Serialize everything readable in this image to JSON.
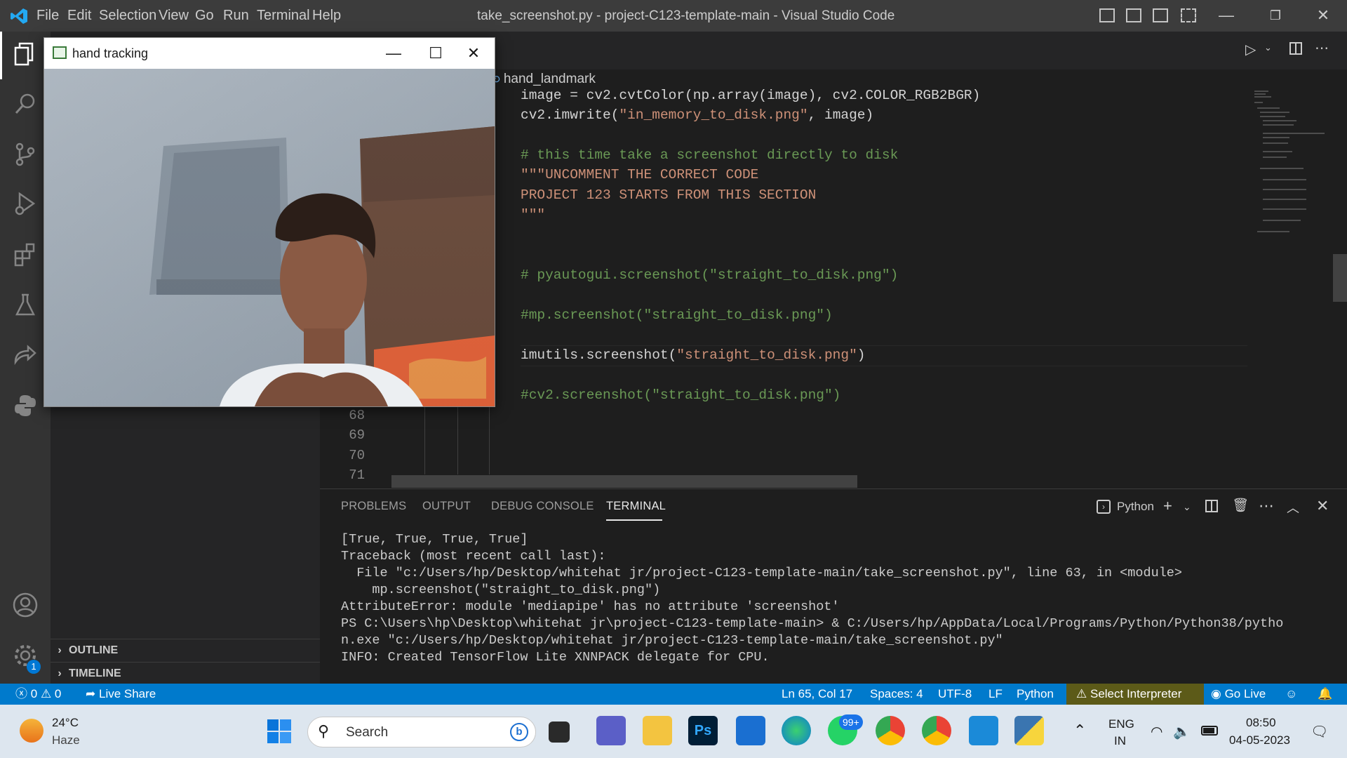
{
  "titlebar": {
    "menu": [
      "File",
      "Edit",
      "Selection",
      "View",
      "Go",
      "Run",
      "Terminal",
      "Help"
    ],
    "window_title": "take_screenshot.py - project-C123-template-main - Visual Studio Code"
  },
  "camera_window": {
    "title": "hand tracking",
    "minimize": "—",
    "maximize": "☐",
    "close": "✕"
  },
  "breadcrumb": {
    "symbol": "hand_landmark"
  },
  "code": {
    "line1_prefix": "image = cv2.cvtColor(np.array(image), cv2.COLOR_RGB2BGR)",
    "line2_a": "cv2.imwrite(",
    "line2_str": "\"in_memory_to_disk.png\"",
    "line2_b": ", image)",
    "comment1": "# this time take a screenshot directly to disk",
    "doc1": "\"\"\"UNCOMMENT THE CORRECT CODE",
    "doc2": "PROJECT 123 STARTS FROM THIS SECTION",
    "doc3": "\"\"\"",
    "comment2": "# pyautogui.screenshot(\"straight_to_disk.png\")",
    "comment3": "#mp.screenshot(\"straight_to_disk.png\")",
    "line_imutils_a": "imutils.screenshot(",
    "line_imutils_str": "\"straight_to_disk.png\"",
    "line_imutils_b": ")",
    "comment4": "#cv2.screenshot(\"straight_to_disk.png\")",
    "line_numbers": [
      "68",
      "69",
      "70",
      "71"
    ]
  },
  "sidebar": {
    "outline": "OUTLINE",
    "timeline": "TIMELINE"
  },
  "panel": {
    "tabs": [
      "PROBLEMS",
      "OUTPUT",
      "DEBUG CONSOLE",
      "TERMINAL"
    ],
    "active_tab": "TERMINAL",
    "shell_label": "Python",
    "terminal_lines": [
      "[True, True, True, True]",
      "Traceback (most recent call last):",
      "  File \"c:/Users/hp/Desktop/whitehat jr/project-C123-template-main/take_screenshot.py\", line 63, in <module>",
      "    mp.screenshot(\"straight_to_disk.png\")",
      "AttributeError: module 'mediapipe' has no attribute 'screenshot'",
      "PS C:\\Users\\hp\\Desktop\\whitehat jr\\project-C123-template-main> & C:/Users/hp/AppData/Local/Programs/Python/Python38/pytho",
      "n.exe \"c:/Users/hp/Desktop/whitehat jr/project-C123-template-main/take_screenshot.py\"",
      "INFO: Created TensorFlow Lite XNNPACK delegate for CPU."
    ]
  },
  "statusbar": {
    "errors": "0",
    "warnings": "0",
    "live_share": "Live Share",
    "position": "Ln 65, Col 17",
    "spaces": "Spaces: 4",
    "encoding": "UTF-8",
    "eol": "LF",
    "language": "Python",
    "interpreter": "Select Interpreter",
    "go_live": "Go Live"
  },
  "taskbar": {
    "weather_temp": "24°C",
    "weather_desc": "Haze",
    "search_placeholder": "Search",
    "badge_whatsapp": "99+",
    "settings_badge": "1",
    "lang1": "ENG",
    "lang2": "IN",
    "time": "08:50",
    "date": "04-05-2023"
  },
  "colors": {
    "statusbar": "#007acc",
    "accent": "#0078d4"
  }
}
